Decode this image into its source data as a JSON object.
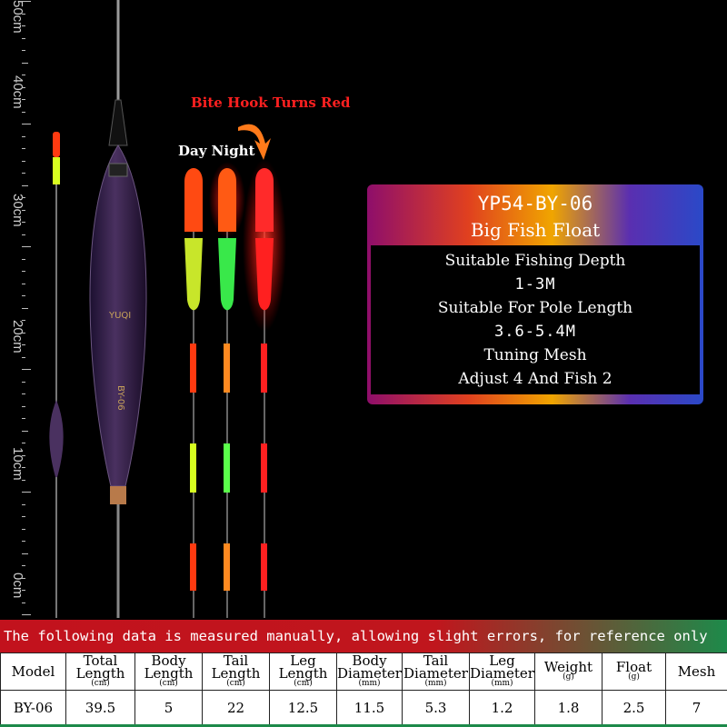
{
  "ruler": {
    "labels": [
      "50cm",
      "40cm",
      "30cm",
      "20cm",
      "10cm",
      "0cm"
    ]
  },
  "callouts": {
    "bite": "Bite Hook Turns Red",
    "day_night": "Day Night"
  },
  "float_text": {
    "model_mark": "BY-06",
    "brand": "YUQI"
  },
  "panel": {
    "title": "YP54-BY-06",
    "subtitle": "Big Fish Float",
    "lines": [
      "Suitable Fishing Depth",
      "1-3M",
      "Suitable For Pole Length",
      "3.6-5.4M",
      "Tuning Mesh",
      "Adjust 4 And Fish 2"
    ]
  },
  "notice": "The following data is measured manually, allowing slight errors, for reference only",
  "table": {
    "headers": [
      {
        "label": "Model",
        "unit": ""
      },
      {
        "label": "Total Length",
        "unit": "(cm)"
      },
      {
        "label": "Body Length",
        "unit": "(cm)"
      },
      {
        "label": "Tail Length",
        "unit": "(cm)"
      },
      {
        "label": "Leg Length",
        "unit": "(cm)"
      },
      {
        "label": "Body Diameter",
        "unit": "(mm)"
      },
      {
        "label": "Tail Diameter",
        "unit": "(mm)"
      },
      {
        "label": "Leg Diameter",
        "unit": "(mm)"
      },
      {
        "label": "Weight",
        "unit": "(g)"
      },
      {
        "label": "Float",
        "unit": "(g)"
      },
      {
        "label": "Mesh",
        "unit": ""
      }
    ],
    "values": [
      "BY-06",
      "39.5",
      "5",
      "22",
      "12.5",
      "11.5",
      "5.3",
      "1.2",
      "1.8",
      "2.5",
      "7"
    ]
  },
  "colors": {
    "accent_red": "#ff2020",
    "notice_red": "#c2121d",
    "notice_green": "#1d8a4a"
  }
}
